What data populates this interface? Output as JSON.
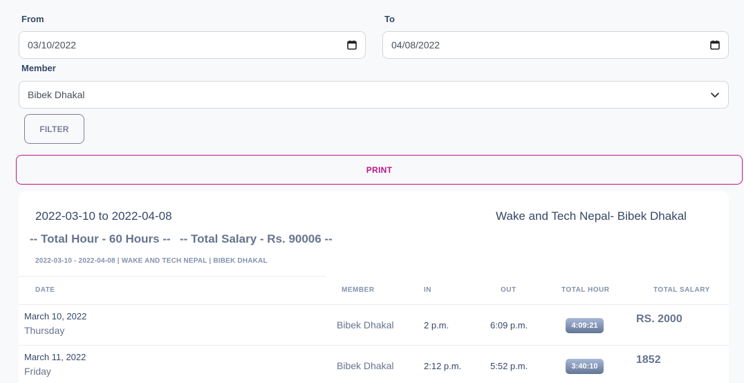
{
  "filters": {
    "from_label": "From",
    "from_value": "03/10/2022",
    "to_label": "To",
    "to_value": "04/08/2022",
    "member_label": "Member",
    "member_value": "Bibek Dhakal",
    "filter_button": "FILTER",
    "print_button": "PRINT"
  },
  "report": {
    "range_title": "2022-03-10 to 2022-04-08",
    "company_title": "Wake and Tech Nepal- Bibek Dhakal",
    "total_hour": "-- Total Hour - 60 Hours --",
    "total_salary": "-- Total Salary - Rs. 90006 --",
    "subline": "2022-03-10 - 2022-04-08 | WAKE AND TECH NEPAL | BIBEK DHAKAL"
  },
  "table": {
    "headers": {
      "date": "DATE",
      "member": "MEMBER",
      "in": "IN",
      "out": "OUT",
      "total_hour": "TOTAL HOUR",
      "total_salary": "TOTAL SALARY"
    },
    "rows": [
      {
        "date": "March 10, 2022",
        "day": "Thursday",
        "member": "Bibek Dhakal",
        "in": "2 p.m.",
        "out": "6:09 p.m.",
        "total_hour": "4:09:21",
        "salary": "RS. 2000"
      },
      {
        "date": "March 11, 2022",
        "day": "Friday",
        "member": "Bibek Dhakal",
        "in": "2:12 p.m.",
        "out": "5:52 p.m.",
        "total_hour": "3:40:10",
        "salary": "1852"
      }
    ]
  },
  "icons": {
    "date_picker": "calendar-icon",
    "select": "chevron-down-icon"
  }
}
